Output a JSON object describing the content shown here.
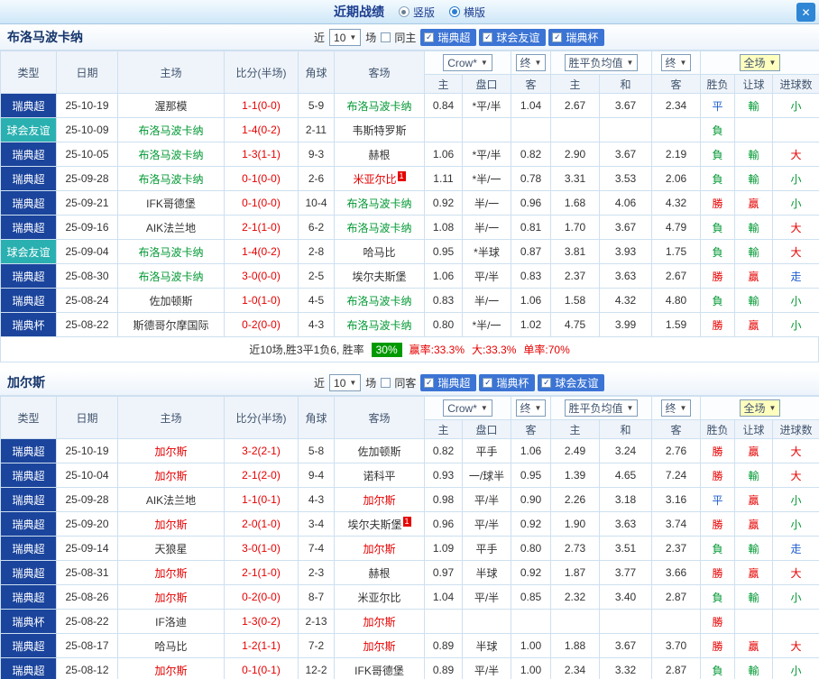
{
  "topbar": {
    "title": "近期战绩",
    "vertical": "竖版",
    "horizontal": "横版",
    "close": "✕"
  },
  "filter": {
    "near": "近",
    "count": "10",
    "games": "场"
  },
  "dropdowns": {
    "odds": "Crow*",
    "final": "终",
    "avg": "胜平负均值",
    "scope": "全场"
  },
  "table_header": {
    "type": "类型",
    "date": "日期",
    "home": "主场",
    "score": "比分(半场)",
    "corner": "角球",
    "away": "客场",
    "h": "主",
    "handicap": "盘口",
    "a": "客",
    "avg_h": "主",
    "avg_d": "和",
    "avg_a": "客",
    "result": "胜负",
    "let_goal": "让球",
    "goal_count": "进球数"
  },
  "sections": [
    {
      "team": "布洛马波卡纳",
      "same": "同主",
      "leagues": [
        "瑞典超",
        "球会友谊",
        "瑞典杯"
      ],
      "rows": [
        {
          "ty": "瑞典超",
          "tc": "navy",
          "d": "25-10-19",
          "h": [
            "渥那模",
            ""
          ],
          "s": "1-1(0-0)",
          "cn": "5-9",
          "a": [
            "布洛马波卡纳",
            "green"
          ],
          "o": [
            "0.84",
            "*平/半",
            "1.04"
          ],
          "v": [
            "2.67",
            "3.67",
            "2.34"
          ],
          "r": [
            "平",
            "blue"
          ],
          "l": [
            "輸",
            "green"
          ],
          "g": [
            "小",
            "green"
          ]
        },
        {
          "ty": "球会友谊",
          "tc": "teal",
          "d": "25-10-09",
          "h": [
            "布洛马波卡纳",
            "green"
          ],
          "s": "1-4(0-2)",
          "cn": "2-11",
          "a": [
            "韦斯特罗斯",
            ""
          ],
          "o": [
            "",
            "",
            ""
          ],
          "v": [
            "",
            "",
            ""
          ],
          "r": [
            "負",
            "green"
          ],
          "l": [
            "",
            ""
          ],
          "g": [
            "",
            ""
          ]
        },
        {
          "ty": "瑞典超",
          "tc": "navy",
          "d": "25-10-05",
          "h": [
            "布洛马波卡纳",
            "green"
          ],
          "s": "1-3(1-1)",
          "cn": "9-3",
          "a": [
            "赫根",
            ""
          ],
          "o": [
            "1.06",
            "*平/半",
            "0.82"
          ],
          "v": [
            "2.90",
            "3.67",
            "2.19"
          ],
          "r": [
            "負",
            "green"
          ],
          "l": [
            "輸",
            "green"
          ],
          "g": [
            "大",
            "red"
          ]
        },
        {
          "ty": "瑞典超",
          "tc": "navy",
          "d": "25-09-28",
          "h": [
            "布洛马波卡纳",
            "green"
          ],
          "s": "0-1(0-0)",
          "cn": "2-6",
          "a": [
            "米亚尔比",
            "red",
            "1"
          ],
          "o": [
            "1.11",
            "*半/一",
            "0.78"
          ],
          "v": [
            "3.31",
            "3.53",
            "2.06"
          ],
          "r": [
            "負",
            "green"
          ],
          "l": [
            "輸",
            "green"
          ],
          "g": [
            "小",
            "green"
          ]
        },
        {
          "ty": "瑞典超",
          "tc": "navy",
          "d": "25-09-21",
          "h": [
            "IFK哥德堡",
            ""
          ],
          "s": "0-1(0-0)",
          "cn": "10-4",
          "a": [
            "布洛马波卡纳",
            "green"
          ],
          "o": [
            "0.92",
            "半/一",
            "0.96"
          ],
          "v": [
            "1.68",
            "4.06",
            "4.32"
          ],
          "r": [
            "勝",
            "red"
          ],
          "l": [
            "贏",
            "red"
          ],
          "g": [
            "小",
            "green"
          ]
        },
        {
          "ty": "瑞典超",
          "tc": "navy",
          "d": "25-09-16",
          "h": [
            "AIK法兰地",
            ""
          ],
          "s": "2-1(1-0)",
          "cn": "6-2",
          "a": [
            "布洛马波卡纳",
            "green"
          ],
          "o": [
            "1.08",
            "半/一",
            "0.81"
          ],
          "v": [
            "1.70",
            "3.67",
            "4.79"
          ],
          "r": [
            "負",
            "green"
          ],
          "l": [
            "輸",
            "green"
          ],
          "g": [
            "大",
            "red"
          ]
        },
        {
          "ty": "球会友谊",
          "tc": "teal",
          "d": "25-09-04",
          "h": [
            "布洛马波卡纳",
            "green"
          ],
          "s": "1-4(0-2)",
          "cn": "2-8",
          "a": [
            "哈马比",
            ""
          ],
          "o": [
            "0.95",
            "*半球",
            "0.87"
          ],
          "v": [
            "3.81",
            "3.93",
            "1.75"
          ],
          "r": [
            "負",
            "green"
          ],
          "l": [
            "輸",
            "green"
          ],
          "g": [
            "大",
            "red"
          ]
        },
        {
          "ty": "瑞典超",
          "tc": "navy",
          "d": "25-08-30",
          "h": [
            "布洛马波卡纳",
            "green"
          ],
          "s": "3-0(0-0)",
          "cn": "2-5",
          "a": [
            "埃尔夫斯堡",
            ""
          ],
          "o": [
            "1.06",
            "平/半",
            "0.83"
          ],
          "v": [
            "2.37",
            "3.63",
            "2.67"
          ],
          "r": [
            "勝",
            "red"
          ],
          "l": [
            "贏",
            "red"
          ],
          "g": [
            "走",
            "blue"
          ]
        },
        {
          "ty": "瑞典超",
          "tc": "navy",
          "d": "25-08-24",
          "h": [
            "佐加顿斯",
            ""
          ],
          "s": "1-0(1-0)",
          "cn": "4-5",
          "a": [
            "布洛马波卡纳",
            "green"
          ],
          "o": [
            "0.83",
            "半/一",
            "1.06"
          ],
          "v": [
            "1.58",
            "4.32",
            "4.80"
          ],
          "r": [
            "負",
            "green"
          ],
          "l": [
            "輸",
            "green"
          ],
          "g": [
            "小",
            "green"
          ]
        },
        {
          "ty": "瑞典杯",
          "tc": "navy",
          "d": "25-08-22",
          "h": [
            "斯德哥尔摩国际",
            ""
          ],
          "s": "0-2(0-0)",
          "cn": "4-3",
          "a": [
            "布洛马波卡纳",
            "green"
          ],
          "o": [
            "0.80",
            "*半/一",
            "1.02"
          ],
          "v": [
            "4.75",
            "3.99",
            "1.59"
          ],
          "r": [
            "勝",
            "red"
          ],
          "l": [
            "贏",
            "red"
          ],
          "g": [
            "小",
            "green"
          ]
        }
      ],
      "summary": {
        "prefix": "近10场,胜3平1负6, 胜率",
        "rate": "30%",
        "win": "赢率:33.3%",
        "big": "大:33.3%",
        "single": "单率:70%"
      }
    },
    {
      "team": "加尔斯",
      "same": "同客",
      "leagues": [
        "瑞典超",
        "瑞典杯",
        "球会友谊"
      ],
      "rows": [
        {
          "ty": "瑞典超",
          "tc": "navy",
          "d": "25-10-19",
          "h": [
            "加尔斯",
            "red"
          ],
          "s": "3-2(2-1)",
          "cn": "5-8",
          "a": [
            "佐加顿斯",
            ""
          ],
          "o": [
            "0.82",
            "平手",
            "1.06"
          ],
          "v": [
            "2.49",
            "3.24",
            "2.76"
          ],
          "r": [
            "勝",
            "red"
          ],
          "l": [
            "贏",
            "red"
          ],
          "g": [
            "大",
            "red"
          ]
        },
        {
          "ty": "瑞典超",
          "tc": "navy",
          "d": "25-10-04",
          "h": [
            "加尔斯",
            "red"
          ],
          "s": "2-1(2-0)",
          "cn": "9-4",
          "a": [
            "诺科平",
            ""
          ],
          "o": [
            "0.93",
            "一/球半",
            "0.95"
          ],
          "v": [
            "1.39",
            "4.65",
            "7.24"
          ],
          "r": [
            "勝",
            "red"
          ],
          "l": [
            "輸",
            "green"
          ],
          "g": [
            "大",
            "red"
          ]
        },
        {
          "ty": "瑞典超",
          "tc": "navy",
          "d": "25-09-28",
          "h": [
            "AIK法兰地",
            ""
          ],
          "s": "1-1(0-1)",
          "cn": "4-3",
          "a": [
            "加尔斯",
            "red"
          ],
          "o": [
            "0.98",
            "平/半",
            "0.90"
          ],
          "v": [
            "2.26",
            "3.18",
            "3.16"
          ],
          "r": [
            "平",
            "blue"
          ],
          "l": [
            "贏",
            "red"
          ],
          "g": [
            "小",
            "green"
          ]
        },
        {
          "ty": "瑞典超",
          "tc": "navy",
          "d": "25-09-20",
          "h": [
            "加尔斯",
            "red"
          ],
          "s": "2-0(1-0)",
          "cn": "3-4",
          "a": [
            "埃尔夫斯堡",
            "",
            "1"
          ],
          "o": [
            "0.96",
            "平/半",
            "0.92"
          ],
          "v": [
            "1.90",
            "3.63",
            "3.74"
          ],
          "r": [
            "勝",
            "red"
          ],
          "l": [
            "贏",
            "red"
          ],
          "g": [
            "小",
            "green"
          ]
        },
        {
          "ty": "瑞典超",
          "tc": "navy",
          "d": "25-09-14",
          "h": [
            "天狼星",
            ""
          ],
          "s": "3-0(1-0)",
          "cn": "7-4",
          "a": [
            "加尔斯",
            "red"
          ],
          "o": [
            "1.09",
            "平手",
            "0.80"
          ],
          "v": [
            "2.73",
            "3.51",
            "2.37"
          ],
          "r": [
            "負",
            "green"
          ],
          "l": [
            "輸",
            "green"
          ],
          "g": [
            "走",
            "blue"
          ]
        },
        {
          "ty": "瑞典超",
          "tc": "navy",
          "d": "25-08-31",
          "h": [
            "加尔斯",
            "red"
          ],
          "s": "2-1(1-0)",
          "cn": "2-3",
          "a": [
            "赫根",
            ""
          ],
          "o": [
            "0.97",
            "半球",
            "0.92"
          ],
          "v": [
            "1.87",
            "3.77",
            "3.66"
          ],
          "r": [
            "勝",
            "red"
          ],
          "l": [
            "贏",
            "red"
          ],
          "g": [
            "大",
            "red"
          ]
        },
        {
          "ty": "瑞典超",
          "tc": "navy",
          "d": "25-08-26",
          "h": [
            "加尔斯",
            "red"
          ],
          "s": "0-2(0-0)",
          "cn": "8-7",
          "a": [
            "米亚尔比",
            ""
          ],
          "o": [
            "1.04",
            "平/半",
            "0.85"
          ],
          "v": [
            "2.32",
            "3.40",
            "2.87"
          ],
          "r": [
            "負",
            "green"
          ],
          "l": [
            "輸",
            "green"
          ],
          "g": [
            "小",
            "green"
          ]
        },
        {
          "ty": "瑞典杯",
          "tc": "navy",
          "d": "25-08-22",
          "h": [
            "IF洛迪",
            ""
          ],
          "s": "1-3(0-2)",
          "cn": "2-13",
          "a": [
            "加尔斯",
            "red"
          ],
          "o": [
            "",
            "",
            ""
          ],
          "v": [
            "",
            "",
            ""
          ],
          "r": [
            "勝",
            "red"
          ],
          "l": [
            "",
            ""
          ],
          "g": [
            "",
            ""
          ]
        },
        {
          "ty": "瑞典超",
          "tc": "navy",
          "d": "25-08-17",
          "h": [
            "哈马比",
            ""
          ],
          "s": "1-2(1-1)",
          "cn": "7-2",
          "a": [
            "加尔斯",
            "red"
          ],
          "o": [
            "0.89",
            "半球",
            "1.00"
          ],
          "v": [
            "1.88",
            "3.67",
            "3.70"
          ],
          "r": [
            "勝",
            "red"
          ],
          "l": [
            "贏",
            "red"
          ],
          "g": [
            "大",
            "red"
          ]
        },
        {
          "ty": "瑞典超",
          "tc": "navy",
          "d": "25-08-12",
          "h": [
            "加尔斯",
            "red"
          ],
          "s": "0-1(0-1)",
          "cn": "12-2",
          "a": [
            "IFK哥德堡",
            ""
          ],
          "o": [
            "0.89",
            "平/半",
            "1.00"
          ],
          "v": [
            "2.34",
            "3.32",
            "2.87"
          ],
          "r": [
            "負",
            "green"
          ],
          "l": [
            "輸",
            "green"
          ],
          "g": [
            "小",
            "green"
          ]
        }
      ]
    }
  ]
}
